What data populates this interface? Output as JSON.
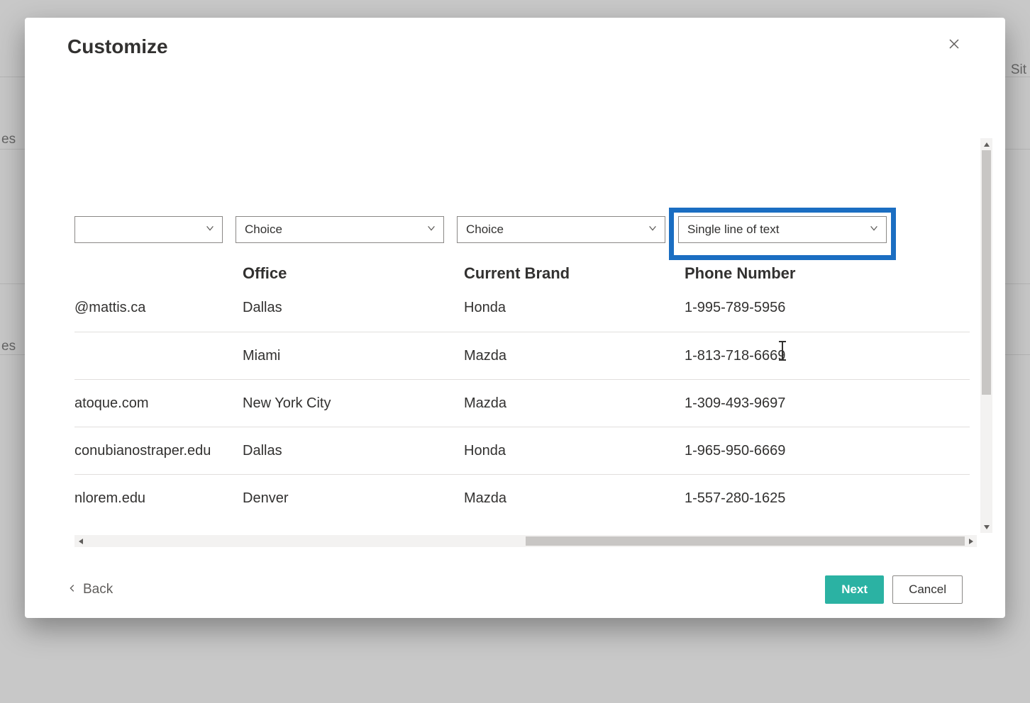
{
  "background": {
    "partial_right_label": "Sit",
    "partial_left_label_1": "es",
    "partial_left_label_2": "es"
  },
  "modal": {
    "title": "Customize",
    "close_label": "Close",
    "footer": {
      "back_label": "Back",
      "next_label": "Next",
      "cancel_label": "Cancel"
    },
    "column_types": [
      {
        "value": ""
      },
      {
        "value": "Choice"
      },
      {
        "value": "Choice"
      },
      {
        "value": "Single line of text",
        "highlighted": true
      }
    ],
    "headers": {
      "col1": "",
      "col2": "Office",
      "col3": "Current Brand",
      "col4": "Phone Number"
    },
    "rows": [
      {
        "c1": "@mattis.ca",
        "c2": "Dallas",
        "c3": "Honda",
        "c4": "1-995-789-5956"
      },
      {
        "c1": "",
        "c2": "Miami",
        "c3": "Mazda",
        "c4": "1-813-718-6669"
      },
      {
        "c1": "atoque.com",
        "c2": "New York City",
        "c3": "Mazda",
        "c4": "1-309-493-9697"
      },
      {
        "c1": "conubianostraper.edu",
        "c2": "Dallas",
        "c3": "Honda",
        "c4": "1-965-950-6669"
      },
      {
        "c1": "nlorem.edu",
        "c2": "Denver",
        "c3": "Mazda",
        "c4": "1-557-280-1625"
      }
    ]
  }
}
